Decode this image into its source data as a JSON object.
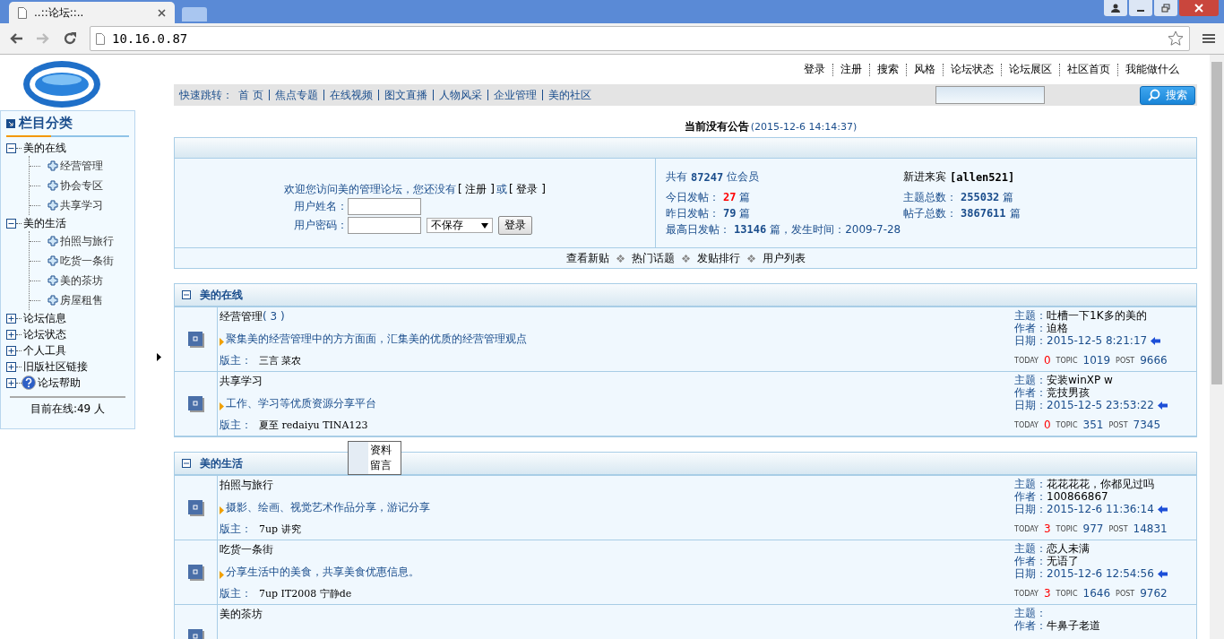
{
  "browser": {
    "tab_title": "..::论坛::..",
    "url": "10.16.0.87"
  },
  "top_links": [
    "登录",
    "注册",
    "搜索",
    "风格",
    "论坛状态",
    "论坛展区",
    "社区首页",
    "我能做什么"
  ],
  "quick_jump": {
    "label": "快速跳转：",
    "links": [
      "首 页",
      "焦点专题",
      "在线视频",
      "图文直播",
      "人物风采",
      "企业管理",
      "美的社区"
    ]
  },
  "search": {
    "button": "搜索"
  },
  "sidebar": {
    "title": "栏目分类",
    "tree": [
      {
        "label": "美的在线",
        "kind": "folder",
        "expanded": true,
        "children": [
          {
            "label": "经营管理"
          },
          {
            "label": "协会专区"
          },
          {
            "label": "共享学习"
          }
        ]
      },
      {
        "label": "美的生活",
        "kind": "folder",
        "expanded": true,
        "children": [
          {
            "label": "拍照与旅行"
          },
          {
            "label": "吃货一条街"
          },
          {
            "label": "美的茶坊"
          },
          {
            "label": "房屋租售"
          }
        ]
      },
      {
        "label": "论坛信息",
        "kind": "folder",
        "expanded": false
      },
      {
        "label": "论坛状态",
        "kind": "folder",
        "expanded": false
      },
      {
        "label": "个人工具",
        "kind": "folder",
        "expanded": false
      },
      {
        "label": "旧版社区链接",
        "kind": "folder",
        "expanded": false
      },
      {
        "label": "论坛帮助",
        "kind": "help",
        "expanded": false
      }
    ],
    "online": "目前在线:49 人"
  },
  "notice": {
    "title": "当前没有公告",
    "time": "(2015-12-6 14:14:37)"
  },
  "login": {
    "welcome": "欢迎您访问美的管理论坛，您还没有",
    "register": "[ 注册 ]",
    "or": "或",
    "login_link": "[ 登录 ]",
    "username_label": "用户姓名：",
    "password_label": "用户密码：",
    "save_select": "不保存",
    "button": "登录"
  },
  "stats_left": [
    {
      "label": "共有",
      "value": "87247",
      "unit": "位会员",
      "highlight": false
    },
    {
      "label": "今日发帖：",
      "value": "27",
      "unit": "篇",
      "highlight": true
    },
    {
      "label": "昨日发帖：",
      "value": "79",
      "unit": "篇",
      "highlight": false
    },
    {
      "label": "最高日发帖：",
      "value": "13146",
      "unit": "篇，发生时间：2009-7-28",
      "highlight": false
    }
  ],
  "stats_right": [
    {
      "label": "新进来宾",
      "value": "[allen521]",
      "kind": "guest"
    },
    {
      "label": "主题总数：",
      "value": "255032",
      "unit": "篇",
      "kind": "count"
    },
    {
      "label": "帖子总数：",
      "value": "3867611",
      "unit": "篇",
      "kind": "count"
    }
  ],
  "links": [
    "查看新贴",
    "热门话题",
    "发贴排行",
    "用户列表"
  ],
  "sections": [
    {
      "title": "美的在线",
      "expanded": true,
      "forums": [
        {
          "name": "经营管理",
          "count": "( 3 )",
          "description": "聚集美的经营管理中的方方面面，汇集美的优质的经营管理观点",
          "moderators_label": "版主：",
          "moderators": "三言 菜农",
          "last": [
            {
              "label": "主题：",
              "value": "吐槽一下1K多的美的",
              "kind": "text"
            },
            {
              "label": "作者：",
              "value": "迫格",
              "kind": "text"
            },
            {
              "label": "日期：",
              "value": "2015-12-5 8:21:17",
              "kind": "date"
            }
          ],
          "stats": [
            {
              "label": "TODAY",
              "value": "0"
            },
            {
              "label": "TOPIC",
              "value": "1019"
            },
            {
              "label": "POST",
              "value": "9666"
            }
          ]
        },
        {
          "name": "共享学习",
          "description": "工作、学习等优质资源分享平台",
          "moderators_label": "版主：",
          "moderators": "夏至 redaiyu TINA123",
          "last": [
            {
              "label": "主题：",
              "value": "安装winXP w",
              "kind": "text"
            },
            {
              "label": "作者：",
              "value": "竞技男孩",
              "kind": "text"
            },
            {
              "label": "日期：",
              "value": "2015-12-5 23:53:22",
              "kind": "date"
            }
          ],
          "stats": [
            {
              "label": "TODAY",
              "value": "0"
            },
            {
              "label": "TOPIC",
              "value": "351"
            },
            {
              "label": "POST",
              "value": "7345"
            }
          ]
        }
      ]
    },
    {
      "title": "美的生活",
      "expanded": true,
      "forums": [
        {
          "name": "拍照与旅行",
          "description": "摄影、绘画、视觉艺术作品分享，游记分享",
          "moderators_label": "版主：",
          "moderators": "7up 讲究",
          "last": [
            {
              "label": "主题：",
              "value": "花花花花，你都见过吗",
              "kind": "text"
            },
            {
              "label": "作者：",
              "value": "100866867",
              "kind": "text"
            },
            {
              "label": "日期：",
              "value": "2015-12-6 11:36:14",
              "kind": "date"
            }
          ],
          "stats": [
            {
              "label": "TODAY",
              "value": "3"
            },
            {
              "label": "TOPIC",
              "value": "977"
            },
            {
              "label": "POST",
              "value": "14831"
            }
          ]
        },
        {
          "name": "吃货一条街",
          "description": "分享生活中的美食，共享美食优惠信息。",
          "moderators_label": "版主：",
          "moderators": "7up IT2008 宁静de",
          "last": [
            {
              "label": "主题：",
              "value": "恋人未满",
              "kind": "text"
            },
            {
              "label": "作者：",
              "value": "无语了",
              "kind": "text"
            },
            {
              "label": "日期：",
              "value": "2015-12-6 12:54:56",
              "kind": "date"
            }
          ],
          "stats": [
            {
              "label": "TODAY",
              "value": "3"
            },
            {
              "label": "TOPIC",
              "value": "1646"
            },
            {
              "label": "POST",
              "value": "9762"
            }
          ]
        },
        {
          "name": "美的茶坊",
          "last": [
            {
              "label": "主题：",
              "kind": "text"
            },
            {
              "label": "作者：",
              "value": "牛鼻子老道",
              "kind": "text"
            }
          ]
        }
      ]
    }
  ],
  "popup_menu": [
    "资料",
    "留言"
  ]
}
